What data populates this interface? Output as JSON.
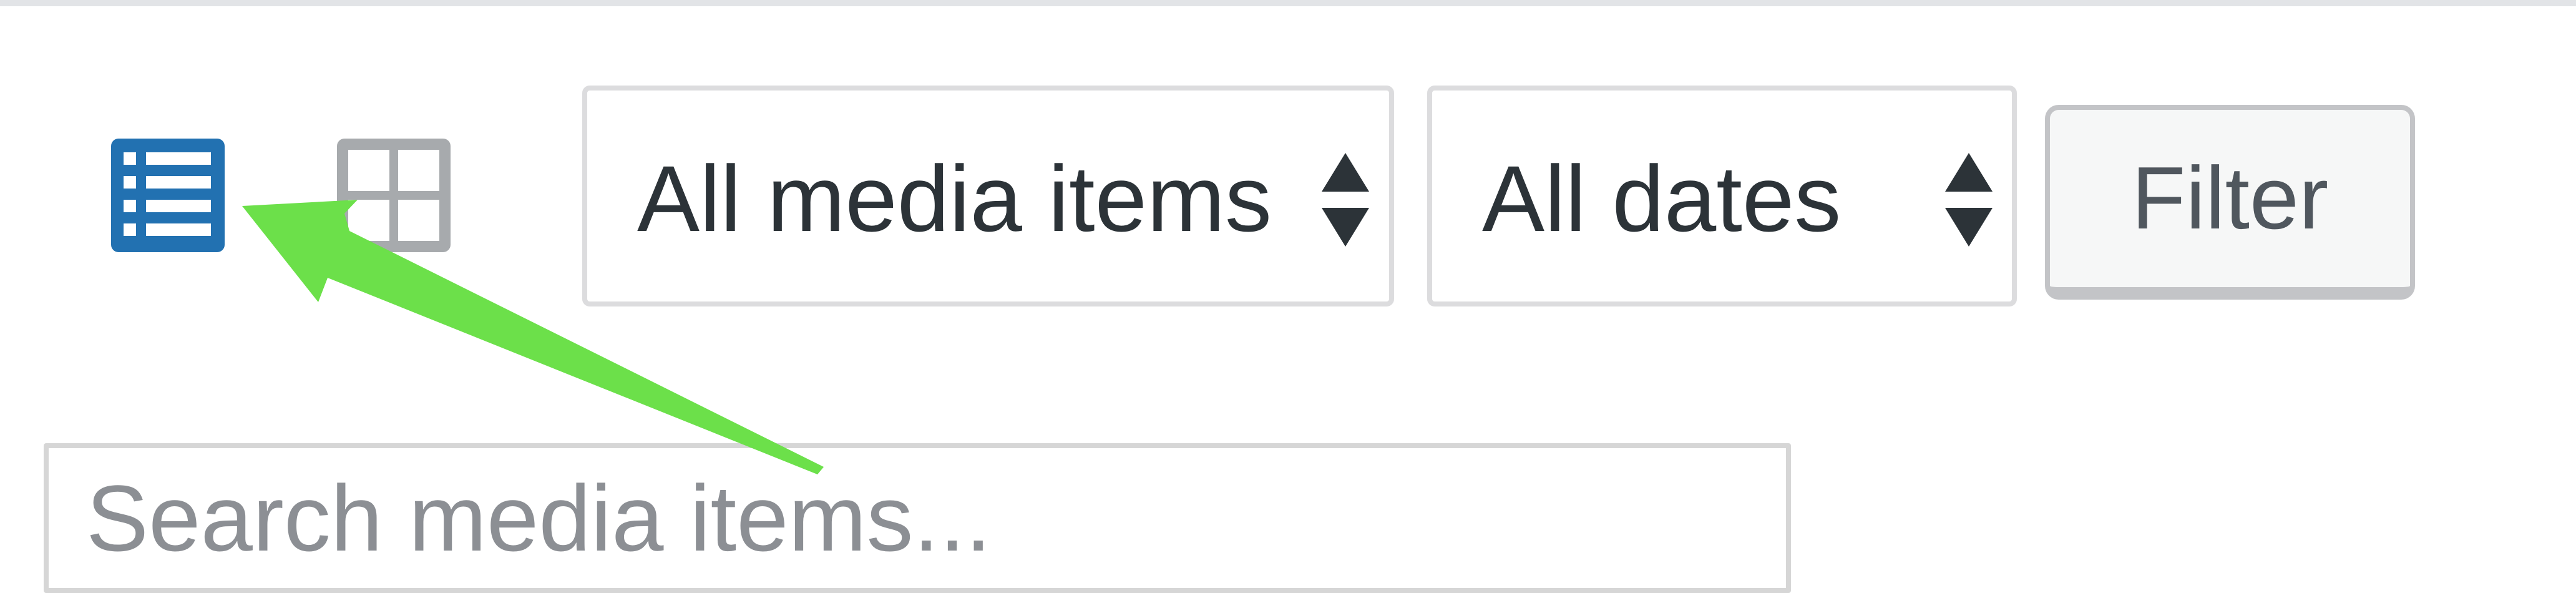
{
  "toolbar": {
    "view_modes": [
      {
        "icon": "list-view-icon",
        "state": "active",
        "color": "#2271b1"
      },
      {
        "icon": "grid-view-icon",
        "state": "inactive",
        "color": "#a7aaad"
      }
    ],
    "media_type_filter": {
      "selected": "All media items",
      "icon": "up-down-arrows-icon"
    },
    "date_filter": {
      "selected": "All dates",
      "icon": "up-down-arrows-icon"
    },
    "filter_button_label": "Filter"
  },
  "search": {
    "placeholder": "Search media items..."
  },
  "annotation": {
    "icon": "pointer-arrow-icon",
    "color": "#6ce04a"
  }
}
